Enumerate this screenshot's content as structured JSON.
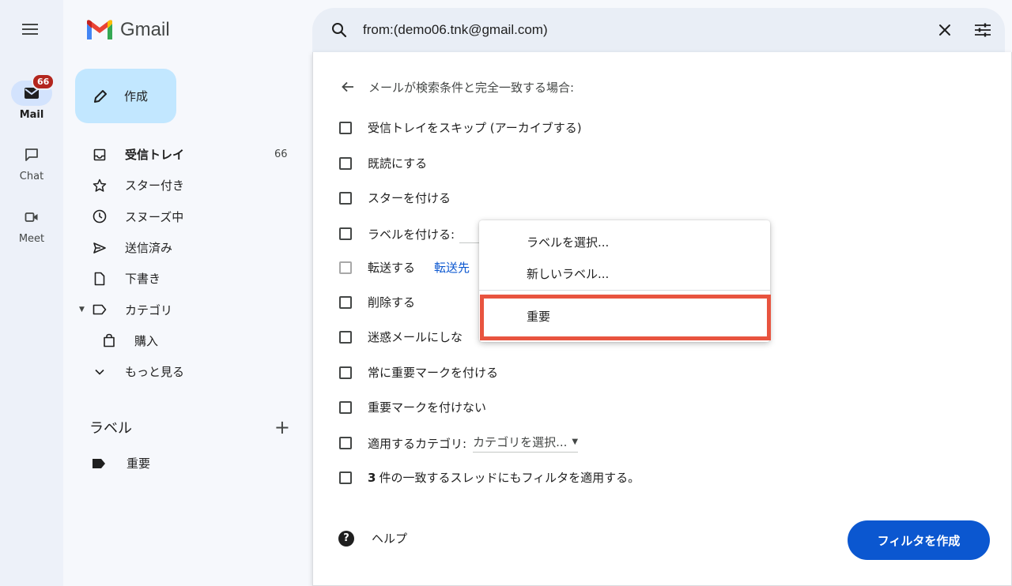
{
  "app": {
    "name": "Gmail"
  },
  "rail": {
    "mail": {
      "label": "Mail",
      "badge": "66"
    },
    "chat": {
      "label": "Chat"
    },
    "meet": {
      "label": "Meet"
    }
  },
  "search": {
    "value": "from:(demo06.tnk@gmail.com)"
  },
  "compose": {
    "label": "作成"
  },
  "nav": {
    "inbox": {
      "label": "受信トレイ",
      "count": "66"
    },
    "starred": {
      "label": "スター付き"
    },
    "snoozed": {
      "label": "スヌーズ中"
    },
    "sent": {
      "label": "送信済み"
    },
    "drafts": {
      "label": "下書き"
    },
    "categories": {
      "label": "カテゴリ"
    },
    "purchases": {
      "label": "購入"
    },
    "more": {
      "label": "もっと見る"
    }
  },
  "labels": {
    "heading": "ラベル",
    "items": [
      {
        "label": "重要"
      }
    ]
  },
  "filter": {
    "heading": "メールが検索条件と完全一致する場合:",
    "options": {
      "skip_inbox": "受信トレイをスキップ (アーカイブする)",
      "mark_read": "既読にする",
      "star": "スターを付ける",
      "apply_label": "ラベルを付ける:",
      "forward": "転送する",
      "forward_link": "転送先",
      "delete": "削除する",
      "never_spam": "迷惑メールにしな",
      "always_important": "常に重要マークを付ける",
      "never_important": "重要マークを付けない",
      "category": "適用するカテゴリ:",
      "category_select": "カテゴリを選択...",
      "apply_count": "3",
      "apply_existing": "件の一致するスレッドにもフィルタを適用する。"
    },
    "help": "ヘルプ",
    "create_button": "フィルタを作成"
  },
  "label_dropdown": {
    "items": [
      "ラベルを選択...",
      "新しいラベル...",
      "重要"
    ],
    "highlighted": "重要"
  },
  "colors": {
    "accent": "#0b57d0",
    "compose_bg": "#c2e7ff",
    "badge": "#b3261e",
    "highlight_border": "#e8543f"
  }
}
